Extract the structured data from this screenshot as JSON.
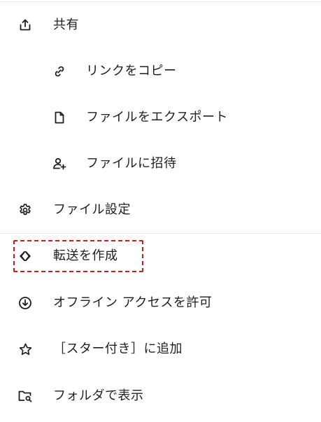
{
  "menu": {
    "items": [
      {
        "id": "share",
        "label": "共有",
        "icon": "share-icon"
      },
      {
        "id": "copy-link",
        "label": "リンクをコピー",
        "icon": "link-icon"
      },
      {
        "id": "export-file",
        "label": "ファイルをエクスポート",
        "icon": "file-icon"
      },
      {
        "id": "invite-file",
        "label": "ファイルに招待",
        "icon": "person-add-icon"
      },
      {
        "id": "file-settings",
        "label": "ファイル設定",
        "icon": "gear-icon"
      },
      {
        "id": "create-transfer",
        "label": "転送を作成",
        "icon": "transfer-icon"
      },
      {
        "id": "offline-access",
        "label": "オフライン アクセスを許可",
        "icon": "download-circle-icon"
      },
      {
        "id": "add-starred",
        "label": "［スター付き］に追加",
        "icon": "star-icon"
      },
      {
        "id": "show-in-folder",
        "label": "フォルダで表示",
        "icon": "folder-search-icon"
      }
    ]
  },
  "highlight": {
    "target": "create-transfer",
    "color": "#d31a1a"
  }
}
